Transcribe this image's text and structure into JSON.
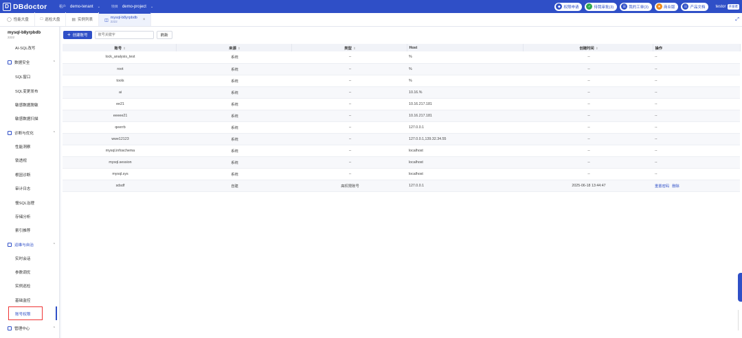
{
  "brand": {
    "name": "DBdoctor"
  },
  "header": {
    "tenant_label": "租户",
    "tenant_value": "demo-tenant",
    "project_label": "项目",
    "project_value": "demo-project",
    "actions": [
      {
        "label": "权限申请",
        "color": "#2f4fc7"
      },
      {
        "label": "待我审批(3)",
        "color": "#2fa84f"
      },
      {
        "label": "我的工单(3)",
        "color": "#2f4fc7"
      },
      {
        "label": "商业版",
        "color": "#f08a1c"
      },
      {
        "label": "产品文档",
        "color": "#2f4fc7"
      }
    ],
    "user": "testor",
    "user_badge": "开发者"
  },
  "tabs": [
    {
      "label": "性能大盘"
    },
    {
      "label": "巡检大盘"
    },
    {
      "label": "实例列表"
    },
    {
      "label": "mysql-b8yrpbdb",
      "sub": "2222",
      "active": true
    }
  ],
  "sidebar": {
    "instance_name": "mysql-b8yrpbdb",
    "instance_sub": "2222",
    "items": [
      "AI-SQL改写",
      "数据安全",
      "SQL窗口",
      "SQL变更发布",
      "敏感数据脱敏",
      "敏感数据扫描",
      "诊断与优化",
      "性能洞察",
      "锁透视",
      "根因诊断",
      "审计日志",
      "慢SQL治理",
      "存储分析",
      "索引推荐",
      "运维与自治",
      "实时会话",
      "参数调优",
      "实例巡检",
      "基础监控",
      "账号权限",
      "管理中心"
    ]
  },
  "toolbar": {
    "create_label": "创建账号",
    "search_placeholder": "账号关键字",
    "refresh_label": "刷新"
  },
  "table": {
    "columns": [
      "账号",
      "来源",
      "类型",
      "Host",
      "创建时间",
      "操作"
    ],
    "rows": [
      [
        "lock_analysis_test",
        "系统",
        "--",
        "%",
        "--",
        "--"
      ],
      [
        "root",
        "系统",
        "--",
        "%",
        "--",
        "--"
      ],
      [
        "tools",
        "系统",
        "--",
        "%",
        "--",
        "--"
      ],
      [
        "ai",
        "系统",
        "--",
        "10.16.%",
        "--",
        "--"
      ],
      [
        "ee21",
        "系统",
        "--",
        "10.16.217.181",
        "--",
        "--"
      ],
      [
        "eeeee21",
        "系统",
        "--",
        "10.16.217.181",
        "--",
        "--"
      ],
      [
        "qeerrb",
        "系统",
        "--",
        "127.0.0.1",
        "--",
        "--"
      ],
      [
        "wwe12123",
        "系统",
        "--",
        "127.0.0.1,139.32.34.55",
        "--",
        "--"
      ],
      [
        "mysql.infoschema",
        "系统",
        "--",
        "localhost",
        "--",
        "--"
      ],
      [
        "mysql.session",
        "系统",
        "--",
        "localhost",
        "--",
        "--"
      ],
      [
        "mysql.sys",
        "系统",
        "--",
        "localhost",
        "--",
        "--"
      ],
      [
        "sdsdf",
        "自建",
        "高权限账号",
        "127.0.0.1",
        "2025-06-18 13:44:47",
        "ops"
      ]
    ],
    "ops": [
      "重置密码",
      "删除"
    ]
  }
}
